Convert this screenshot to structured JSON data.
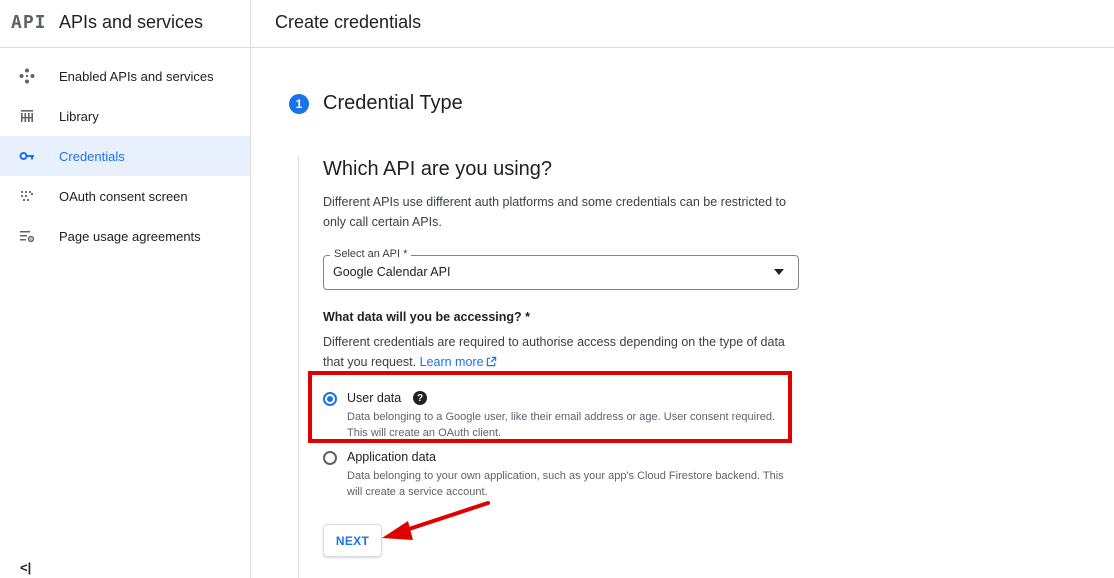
{
  "sidebar": {
    "brand_logo": "API",
    "brand_title": "APIs and services",
    "items": [
      {
        "label": "Enabled APIs and services",
        "icon": "diamond-dots-icon"
      },
      {
        "label": "Library",
        "icon": "library-icon"
      },
      {
        "label": "Credentials",
        "icon": "key-icon",
        "active": true
      },
      {
        "label": "OAuth consent screen",
        "icon": "dots-grid-icon"
      },
      {
        "label": "Page usage agreements",
        "icon": "list-settings-icon"
      }
    ],
    "collapse_label": "<|"
  },
  "header": {
    "title": "Create credentials"
  },
  "step": {
    "number": "1",
    "title": "Credential Type"
  },
  "section": {
    "title": "Which API are you using?",
    "description": "Different APIs use different auth platforms and some credentials can be restricted to only call certain APIs."
  },
  "api_select": {
    "label": "Select an API *",
    "value": "Google Calendar API"
  },
  "data_question": {
    "title": "What data will you be accessing? *",
    "description": "Different credentials are required to authorise access depending on the type of data that you request.",
    "learn_more": "Learn more"
  },
  "options": [
    {
      "label": "User data",
      "description": "Data belonging to a Google user, like their email address or age. User consent required. This will create an OAuth client.",
      "checked": true
    },
    {
      "label": "Application data",
      "description": "Data belonging to your own application, such as your app's Cloud Firestore backend. This will create a service account.",
      "checked": false
    }
  ],
  "help_glyph": "?",
  "next_button": "NEXT",
  "colors": {
    "accent": "#1a73e8",
    "annotation_red": "#e00000",
    "active_bg": "#e8f0fe"
  }
}
